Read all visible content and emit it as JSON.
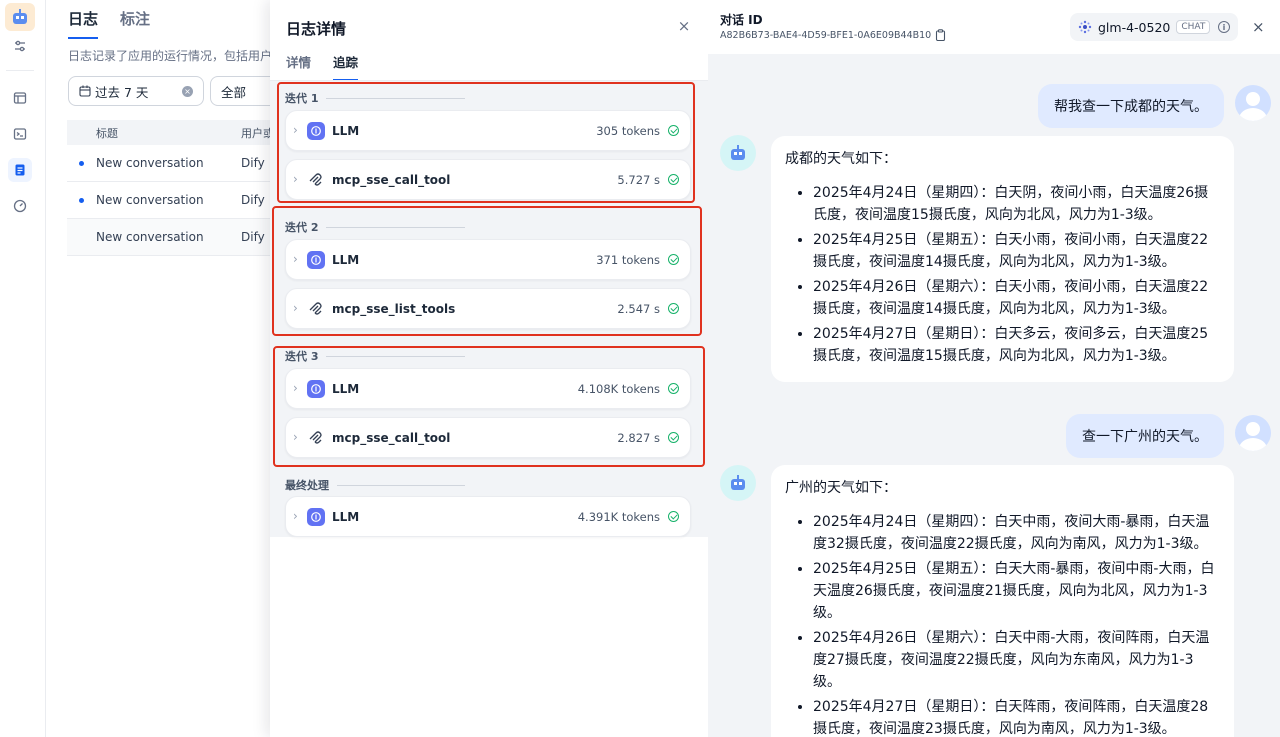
{
  "main": {
    "tabs": [
      "日志",
      "标注"
    ],
    "description": "日志记录了应用的运行情况，包括用户",
    "date_filter": "过去 7 天",
    "status_filter": "全部",
    "columns": [
      "标题",
      "用户或"
    ],
    "rows": [
      {
        "title": "New conversation",
        "user": "Dify",
        "unread": true
      },
      {
        "title": "New conversation",
        "user": "Dify",
        "unread": true
      },
      {
        "title": "New conversation",
        "user": "Dify",
        "unread": false
      }
    ]
  },
  "panel": {
    "title": "日志详情",
    "close": "×",
    "tabs": [
      "详情",
      "追踪"
    ],
    "groups": [
      {
        "label": "迭代 1",
        "items": [
          {
            "name": "LLM",
            "meta": "305 tokens",
            "icon": "llm-icon"
          },
          {
            "name": "mcp_sse_call_tool",
            "meta": "5.727 s",
            "icon": "tool-icon"
          }
        ]
      },
      {
        "label": "迭代 2",
        "items": [
          {
            "name": "LLM",
            "meta": "371 tokens",
            "icon": "llm-icon"
          },
          {
            "name": "mcp_sse_list_tools",
            "meta": "2.547 s",
            "icon": "tool-icon"
          }
        ]
      },
      {
        "label": "迭代 3",
        "items": [
          {
            "name": "LLM",
            "meta": "4.108K tokens",
            "icon": "llm-icon"
          },
          {
            "name": "mcp_sse_call_tool",
            "meta": "2.827 s",
            "icon": "tool-icon"
          }
        ]
      },
      {
        "label": "最终处理",
        "items": [
          {
            "name": "LLM",
            "meta": "4.391K tokens",
            "icon": "llm-icon"
          }
        ]
      }
    ]
  },
  "chat": {
    "id_label": "对话 ID",
    "id_value": "A82B6B73-BAE4-4D59-BFE1-0A6E09B44B10",
    "model": "glm-4-0520",
    "model_badge": "CHAT",
    "close": "×",
    "messages": [
      {
        "role": "user",
        "text": "帮我查一下成都的天气。"
      },
      {
        "role": "assistant",
        "intro": "成都的天气如下：",
        "items": [
          "2025年4月24日（星期四）：白天阴，夜间小雨，白天温度26摄氏度，夜间温度15摄氏度，风向为北风，风力为1-3级。",
          "2025年4月25日（星期五）：白天小雨，夜间小雨，白天温度22摄氏度，夜间温度14摄氏度，风向为北风，风力为1-3级。",
          "2025年4月26日（星期六）：白天小雨，夜间小雨，白天温度22摄氏度，夜间温度14摄氏度，风向为北风，风力为1-3级。",
          "2025年4月27日（星期日）：白天多云，夜间多云，白天温度25摄氏度，夜间温度15摄氏度，风向为北风，风力为1-3级。"
        ]
      },
      {
        "role": "user",
        "text": "查一下广州的天气。"
      },
      {
        "role": "assistant",
        "intro": "广州的天气如下：",
        "items": [
          "2025年4月24日（星期四）：白天中雨，夜间大雨-暴雨，白天温度32摄氏度，夜间温度22摄氏度，风向为南风，风力为1-3级。",
          "2025年4月25日（星期五）：白天大雨-暴雨，夜间中雨-大雨，白天温度26摄氏度，夜间温度21摄氏度，风向为北风，风力为1-3级。",
          "2025年4月26日（星期六）：白天中雨-大雨，夜间阵雨，白天温度27摄氏度，夜间温度22摄氏度，风向为东南风，风力为1-3级。",
          "2025年4月27日（星期日）：白天阵雨，夜间阵雨，白天温度28摄氏度，夜间温度23摄氏度，风向为南风，风力为1-3级。"
        ]
      }
    ]
  },
  "colors": {
    "accent": "#155eef",
    "highlight_box": "#e0321f",
    "success": "#17b26a"
  }
}
